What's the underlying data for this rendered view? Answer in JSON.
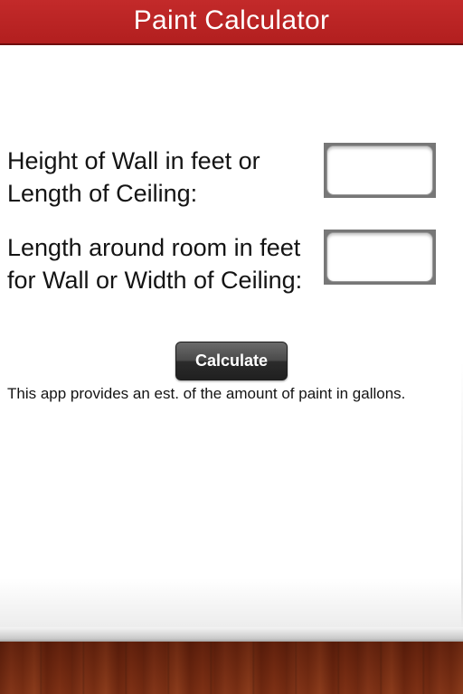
{
  "header": {
    "title": "Paint Calculator"
  },
  "form": {
    "height_label": "Height of Wall in feet or Length of Ceiling:",
    "height_value": "",
    "length_label": "Length around room in feet for Wall or Width of Ceiling:",
    "length_value": "",
    "calculate_label": "Calculate"
  },
  "info": {
    "text": "This app provides an est. of the amount of paint in gallons."
  },
  "colors": {
    "title_bar": "#b52323",
    "title_text": "#ffffff",
    "button": "#3a3a3a",
    "floor": "#a8653f"
  }
}
